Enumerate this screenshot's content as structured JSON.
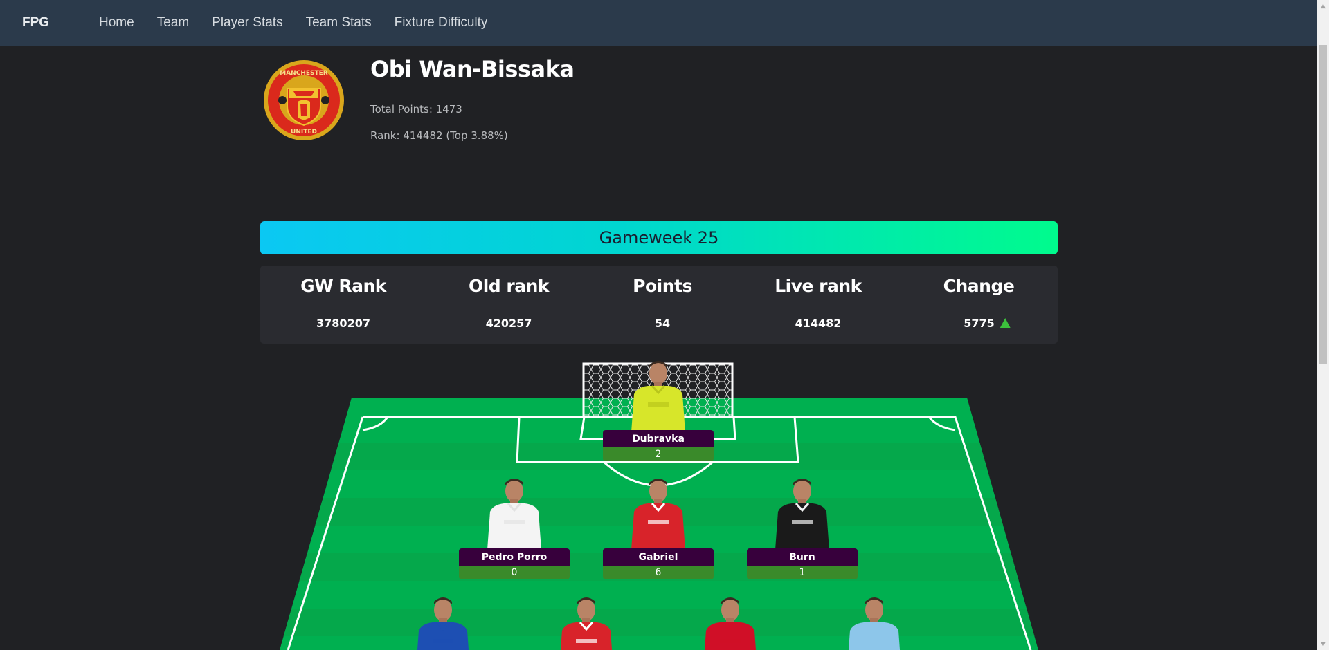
{
  "nav": {
    "brand": "FPG",
    "links": [
      "Home",
      "Team",
      "Player Stats",
      "Team Stats",
      "Fixture Difficulty"
    ]
  },
  "header": {
    "team_name": "Obi Wan-Bissaka",
    "total_points": "Total Points: 1473",
    "rank": "Rank: 414482 (Top 3.88%)",
    "crest_lettering": "MANCHESTER UNITED"
  },
  "gameweek": {
    "label": "Gameweek 25"
  },
  "stats": {
    "headers": [
      "GW Rank",
      "Old rank",
      "Points",
      "Live rank",
      "Change"
    ],
    "values": [
      "3780207",
      "420257",
      "54",
      "414482",
      "5775"
    ],
    "change_direction": "up"
  },
  "players": [
    {
      "name": "Dubravka",
      "points": "2",
      "shirt": "#d7e62a",
      "stripe": "#b9c61b"
    },
    {
      "name": "Pedro Porro",
      "points": "0",
      "shirt": "#f4f4f4",
      "stripe": "#e2e2e2"
    },
    {
      "name": "Gabriel",
      "points": "6",
      "shirt": "#d8232a",
      "stripe": "#ffffff"
    },
    {
      "name": "Burn",
      "points": "1",
      "shirt": "#1a1a1a",
      "stripe": "#f2f2f2"
    },
    {
      "name": "",
      "points": "",
      "shirt": "#1d4fb3",
      "stripe": "#1d4fb3"
    },
    {
      "name": "",
      "points": "",
      "shirt": "#d8232a",
      "stripe": "#ffffff"
    },
    {
      "name": "",
      "points": "",
      "shirt": "#d00f27",
      "stripe": "#d00f27"
    },
    {
      "name": "",
      "points": "",
      "shirt": "#8dc6ea",
      "stripe": "#8dc6ea"
    }
  ],
  "colors": {
    "navbar": "#2b3a4b",
    "background": "#202124",
    "pitch": "#00b050",
    "name_plate": "#37003c",
    "points_plate": "#3a8a2a",
    "banner_start": "#0bc8f3",
    "banner_end": "#00fb8d",
    "change_up": "#3cbf3c"
  }
}
